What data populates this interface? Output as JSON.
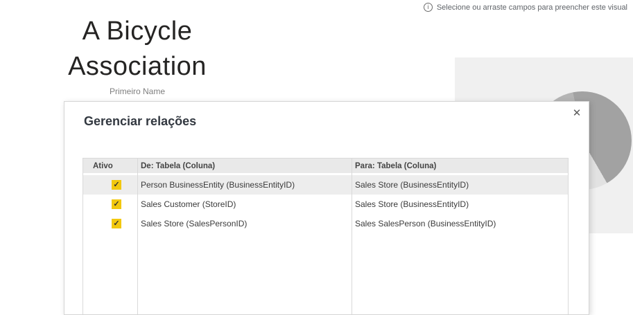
{
  "canvas": {
    "hint": {
      "text": "Selecione ou arraste campos para preencher este visual"
    },
    "title_visual": {
      "title": "A Bicycle Association",
      "subtitle": "Primeiro Name"
    }
  },
  "dialog": {
    "title": "Gerenciar relações",
    "table": {
      "columns": [
        "Ativo",
        "De: Tabela (Coluna)",
        "Para: Tabela (Coluna)"
      ],
      "rows": [
        {
          "active": true,
          "selected": true,
          "from": "Person BusinessEntity (BusinessEntityID)",
          "to": "Sales Store (BusinessEntityID)"
        },
        {
          "active": true,
          "selected": false,
          "from": "Sales Customer (StoreID)",
          "to": "Sales Store (BusinessEntityID)"
        },
        {
          "active": true,
          "selected": false,
          "from": "Sales Store (SalesPersonID)",
          "to": "Sales SalesPerson (BusinessEntityID)"
        }
      ]
    }
  },
  "icons": {
    "info": "i",
    "close": "✕",
    "check": "✓"
  },
  "colors": {
    "accent_yellow": "#F2C80F",
    "selected_row": "#ededed",
    "header_bg": "#e9e9e9",
    "table_border": "#d9d9d9",
    "placeholder_bg": "#f0f0f0",
    "pie_dark": "#a2a2a2",
    "pie_light": "#b5b5b5",
    "pie_pale": "#e2e2e2",
    "title_text": "#252423",
    "hint_text": "#5f6368"
  }
}
